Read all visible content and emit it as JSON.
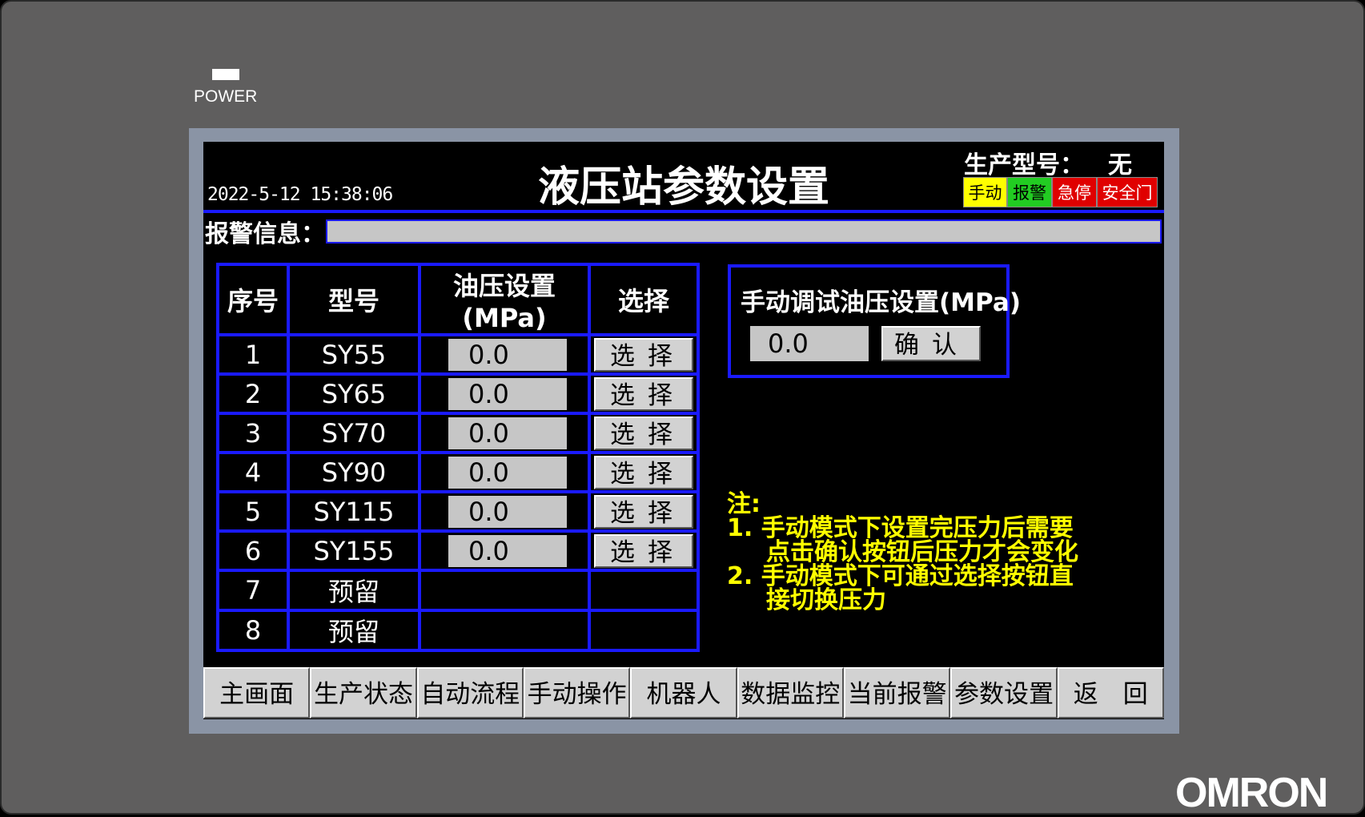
{
  "device": {
    "power_label": "POWER",
    "brand": "OMRON"
  },
  "header": {
    "datetime": "2022-5-12 15:38:06",
    "title": "液压站参数设置",
    "model_label": "生产型号：",
    "model_value": "无",
    "status": {
      "manual": "手动",
      "alarm": "报警",
      "estop": "急停",
      "door": "安全门"
    },
    "colors": {
      "accent_blue": "#1a1aff",
      "manual": "#ffff00",
      "alarm": "#22cc22",
      "danger": "#e00000"
    }
  },
  "alarm": {
    "label": "报警信息：",
    "message": ""
  },
  "table": {
    "headers": [
      "序号",
      "型号",
      "油压设置(MPa)",
      "选择"
    ],
    "rows": [
      {
        "no": "1",
        "model": "SY55",
        "pressure": "0.0",
        "select": "选择"
      },
      {
        "no": "2",
        "model": "SY65",
        "pressure": "0.0",
        "select": "选择"
      },
      {
        "no": "3",
        "model": "SY70",
        "pressure": "0.0",
        "select": "选择"
      },
      {
        "no": "4",
        "model": "SY90",
        "pressure": "0.0",
        "select": "选择"
      },
      {
        "no": "5",
        "model": "SY115",
        "pressure": "0.0",
        "select": "选择"
      },
      {
        "no": "6",
        "model": "SY155",
        "pressure": "0.0",
        "select": "选择"
      },
      {
        "no": "7",
        "model": "预留",
        "pressure": "",
        "select": ""
      },
      {
        "no": "8",
        "model": "预留",
        "pressure": "",
        "select": ""
      }
    ]
  },
  "manual": {
    "title": "手动调试油压设置(MPa)",
    "value": "0.0",
    "confirm": "确认"
  },
  "notes": {
    "heading": "注:",
    "line1": "1. 手动模式下设置完压力后需要",
    "line1b": "点击确认按钮后压力才会变化",
    "line2": "2. 手动模式下可通过选择按钮直",
    "line2b": "接切换压力"
  },
  "nav": [
    "主画面",
    "生产状态",
    "自动流程",
    "手动操作",
    "机器人",
    "数据监控",
    "当前报警",
    "参数设置",
    "返　回"
  ]
}
